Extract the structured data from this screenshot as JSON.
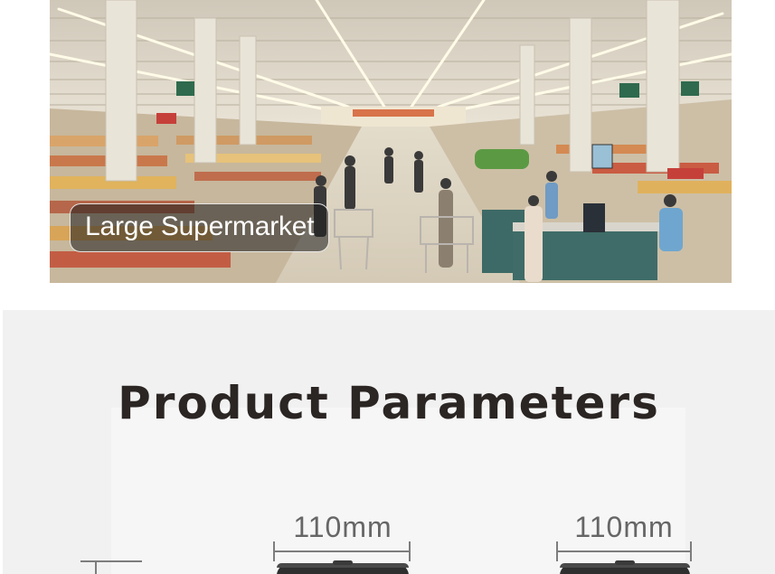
{
  "hero": {
    "scene_label": "Large Supermarket"
  },
  "params": {
    "title": "Product Parameters",
    "products": [
      {
        "width_label": "110mm"
      },
      {
        "width_label": "110mm"
      }
    ]
  },
  "colors": {
    "title": "#2b2523",
    "section_bg": "#f1f1f1",
    "dimension_text": "#666666",
    "product_body": "#2f2f2f"
  }
}
